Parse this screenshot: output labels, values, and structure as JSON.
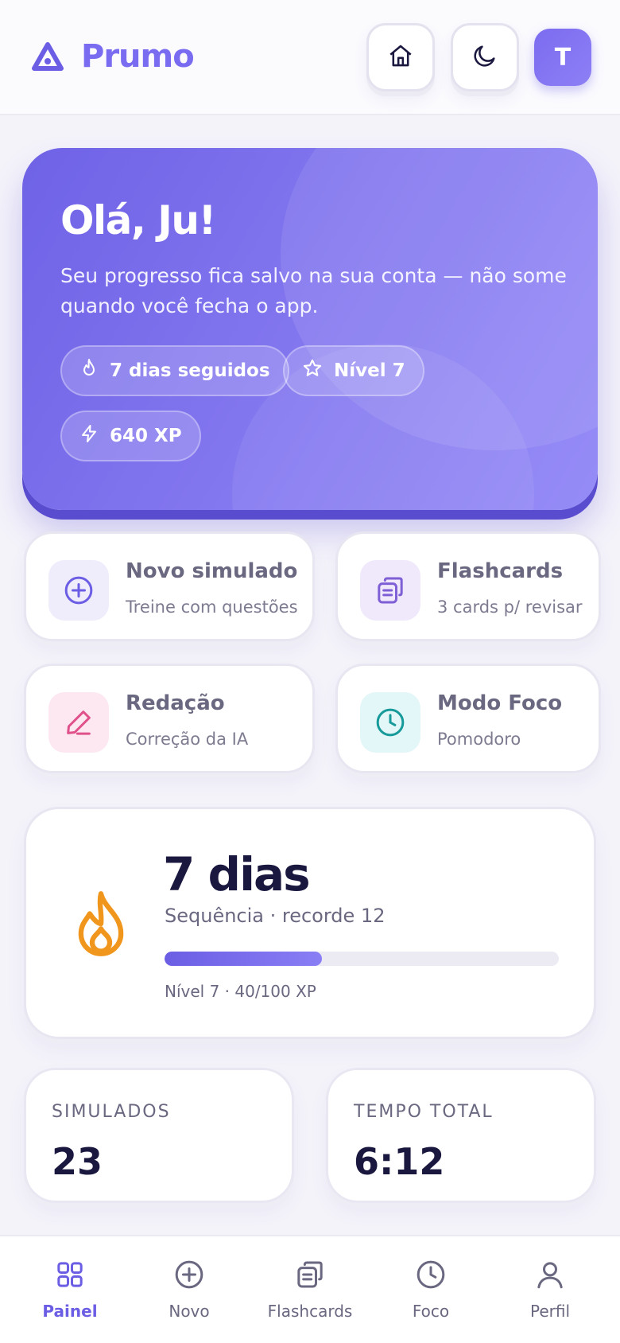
{
  "header": {
    "app_name": "Prumo",
    "avatar_initial": "T"
  },
  "hero": {
    "greeting": "Olá, Ju!",
    "subtitle": "Seu progresso fica salvo na sua conta — não some quando você fecha o app.",
    "pills": [
      {
        "icon": "flame-icon",
        "label": "7 dias seguidos"
      },
      {
        "icon": "star-icon",
        "label": "Nível 7"
      },
      {
        "icon": "bolt-icon",
        "label": "640 XP"
      }
    ]
  },
  "actions": [
    {
      "title": "Novo simulado",
      "subtitle": "Treine com questões",
      "icon": "plus-circle-icon",
      "color": "#6b5ee4",
      "bg": "#efedfb"
    },
    {
      "title": "Flashcards",
      "subtitle": "3 cards p/ revisar",
      "icon": "cards-icon",
      "color": "#7f5fd6",
      "bg": "#efe9fb"
    },
    {
      "title": "Redação",
      "subtitle": "Correção da IA",
      "icon": "pen-icon",
      "color": "#e0508a",
      "bg": "#fde8f1"
    },
    {
      "title": "Modo Foco",
      "subtitle": "Pomodoro",
      "icon": "clock-icon",
      "color": "#169a9a",
      "bg": "#e3f6f8"
    }
  ],
  "streak": {
    "days": "7 dias",
    "subtitle": "Sequência · recorde 12",
    "level_progress": 0.4,
    "level_label": "Nível 7 · 40/100 XP"
  },
  "stats": [
    {
      "label": "SIMULADOS",
      "value": "23"
    },
    {
      "label": "TEMPO TOTAL",
      "value": "6:12"
    }
  ],
  "nav": [
    {
      "label": "Painel",
      "icon": "grid-icon",
      "active": true
    },
    {
      "label": "Novo",
      "icon": "plus-circle-icon",
      "active": false
    },
    {
      "label": "Flashcards",
      "icon": "cards-icon",
      "active": false
    },
    {
      "label": "Foco",
      "icon": "clock-icon",
      "active": false
    },
    {
      "label": "Perfil",
      "icon": "user-icon",
      "active": false
    }
  ],
  "colors": {
    "accent": "#7a6cf0",
    "hero_start": "#6f62e6",
    "hero_end": "#968cf7",
    "flame": "#f0961c"
  }
}
